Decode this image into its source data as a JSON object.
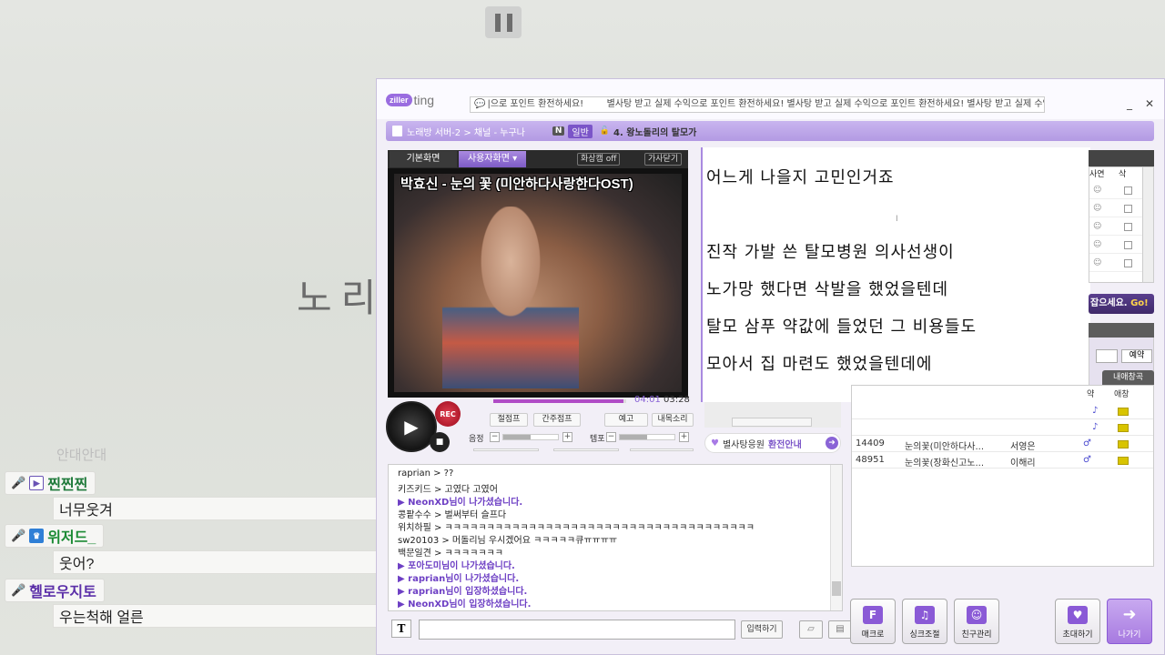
{
  "overlay": {
    "faded_text": "안대안대",
    "users": [
      {
        "name": "찐찐찐",
        "message": "너무웃겨",
        "color": "#1f7a3a",
        "badge": "play"
      },
      {
        "name": "위저드_",
        "message": "웃어?",
        "color": "#1a8a33",
        "badge": "crown"
      },
      {
        "name": "헬로우지토",
        "message": "우는척해 얼른",
        "color": "#5b2fa8",
        "badge": ""
      }
    ]
  },
  "background_text": "노리",
  "window": {
    "logo_z": "ziller",
    "logo_ting": "ting",
    "ticker": "별사탕 받고 실제 수익으로 포인트 환전하세요!          별사탕 받고 실제 수익으로 포인트 환전하세요!          별사탕 받고 실제 수익으로 포인트",
    "ticker_prefix": "|으로 포인트 환전하세요!",
    "nav": {
      "path": "노래방 서버-2 > 채널 - 누구나",
      "n_badge": "N",
      "type": "일반",
      "room_title": "4. 왕노돌리의 탈모가"
    }
  },
  "video": {
    "tab_basic": "기본화면",
    "tab_user": "사용자화면 ▾",
    "screen_state": "화상캠 off",
    "hide_btn": "가사닫기",
    "overlay_title": "박효신 - 눈의 꽃 (미안하다사랑한다OST)",
    "current_time": "04:01",
    "total_time": "03:28",
    "progress": 0.98,
    "buttons": {
      "jump": "절점프",
      "interlude": "간주점프",
      "reserve": "예고",
      "mylist": "내목소리"
    },
    "vol_label": "음정",
    "tempo_label": "템포",
    "rec_label": "REC"
  },
  "lyrics": {
    "lines": [
      "어느게 나을지 고민인거죠",
      "",
      "진작 가발 쓴 탈모병원 의사선생이",
      "노가망 했다면 삭발을 했었을텐데",
      "탈모 삼푸 약값에 들었던 그 비용들도",
      "모아서 집 마련도 했었을텐데에"
    ]
  },
  "star_bar": {
    "prefix": "별사탕응원",
    "bold": "환전안내"
  },
  "right_panel": {
    "col_photo": "사연",
    "col_reserve": "삭",
    "go_text": "잡으세요.",
    "go_label": "Go!",
    "reserve_btn": "예약",
    "my_tab": "내애창곡",
    "song_cols": [
      "약",
      "애창"
    ],
    "songs": [
      {
        "no": "14409",
        "title": "눈의꽃(미안하다사...",
        "artist": "서영은"
      },
      {
        "no": "48951",
        "title": "눈의꽃(장화신고노...",
        "artist": "이해리"
      }
    ]
  },
  "chat": {
    "lines": [
      {
        "text": "raprian > ??",
        "sys": false
      },
      {
        "text": "키즈키드 > 고였다 고였어",
        "sys": false
      },
      {
        "text": "▶ NeonXD님이 나가셨습니다.",
        "sys": true
      },
      {
        "text": "콩팥수수 > 벌써부터 슬프다",
        "sys": false
      },
      {
        "text": "위치하필 > ㅋㅋㅋㅋㅋㅋㅋㅋㅋㅋㅋㅋㅋㅋㅋㅋㅋㅋㅋㅋㅋㅋㅋㅋㅋㅋㅋㅋㅋㅋㅋㅋㅋㅋㅋㅋㅋ",
        "sys": false
      },
      {
        "text": "sw20103 > 머돌리님 우시겠어요 ㅋㅋㅋㅋㅋ큐ㅠㅠㅠㅠ",
        "sys": false
      },
      {
        "text": "백문일견 > ㅋㅋㅋㅋㅋㅋㅋ",
        "sys": false
      },
      {
        "text": "▶ 포아도미님이 나가셨습니다.",
        "sys": true
      },
      {
        "text": "▶ raprian님이 나가셨습니다.",
        "sys": true
      },
      {
        "text": "▶ raprian님이 입장하셨습니다.",
        "sys": true
      },
      {
        "text": "▶ NeonXD님이 입장하셨습니다.",
        "sys": true
      }
    ],
    "input_placeholder": "",
    "send_label": "입력하기"
  },
  "bottom": {
    "macro": "매크로",
    "sync": "싱크조절",
    "friends": "친구관리",
    "invite": "초대하기",
    "exit": "나가기"
  }
}
